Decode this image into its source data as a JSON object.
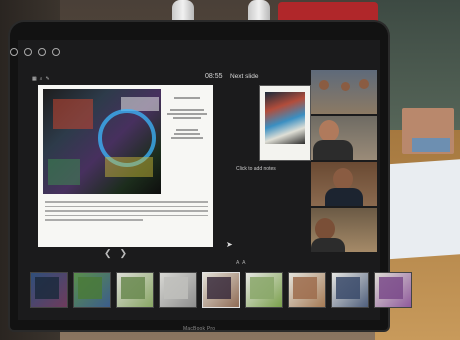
{
  "presenter": {
    "timer": "08:55",
    "next_slide_label": "Next slide",
    "notes_placeholder": "Click to add notes",
    "bezel_brand": "MacBook Pro"
  }
}
